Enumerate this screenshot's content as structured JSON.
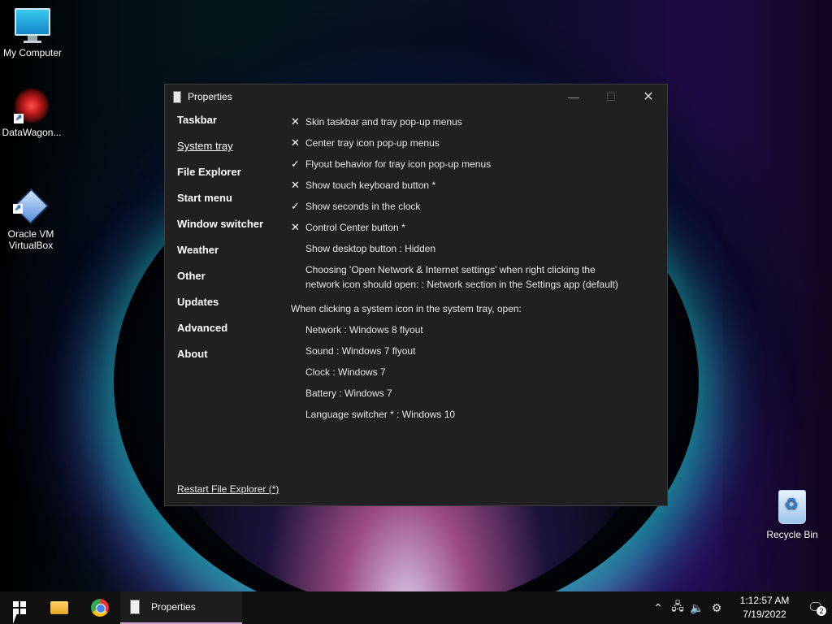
{
  "desktop": {
    "icons": [
      {
        "label": "My Computer"
      },
      {
        "label": "DataWagon..."
      },
      {
        "label": "Oracle VM\nVirtualBox"
      },
      {
        "label": "Recycle Bin"
      }
    ]
  },
  "window": {
    "title": "Properties",
    "controls": {
      "minimize": "—",
      "maximize": "☐",
      "close": "✕"
    },
    "nav": [
      {
        "label": "Taskbar"
      },
      {
        "label": "System tray",
        "active": true
      },
      {
        "label": "File Explorer"
      },
      {
        "label": "Start menu"
      },
      {
        "label": "Window switcher"
      },
      {
        "label": "Weather"
      },
      {
        "label": "Other"
      },
      {
        "label": "Updates"
      },
      {
        "label": "Advanced"
      },
      {
        "label": "About"
      }
    ],
    "settings": [
      {
        "mark": "✕",
        "label": "Skin taskbar and tray pop-up menus"
      },
      {
        "mark": "✕",
        "label": "Center tray icon pop-up menus"
      },
      {
        "mark": "✓",
        "label": "Flyout behavior for tray icon pop-up menus"
      },
      {
        "mark": "✕",
        "label": "Show touch keyboard button *"
      },
      {
        "mark": "✓",
        "label": "Show seconds in the clock"
      },
      {
        "mark": "✕",
        "label": "Control Center button *"
      },
      {
        "mark": "",
        "label": "Show desktop button : Hidden"
      },
      {
        "mark": "",
        "label": "Choosing 'Open Network & Internet settings' when right clicking the network icon should open: : Network section in the Settings app (default)"
      }
    ],
    "tray_section_header": "When clicking a system icon in the system tray, open:",
    "tray_options": [
      {
        "label": "Network : Windows 8 flyout"
      },
      {
        "label": "Sound : Windows 7 flyout"
      },
      {
        "label": "Clock : Windows 7"
      },
      {
        "label": "Battery : Windows 7"
      },
      {
        "label": "Language switcher * : Windows 10"
      }
    ],
    "restart_link": "Restart File Explorer (*)"
  },
  "taskbar": {
    "active_task": "Properties",
    "tray_icons": [
      "chevron-up-icon",
      "network-icon",
      "volume-icon",
      "gear-icon"
    ],
    "clock_time": "1:12:57 AM",
    "clock_date": "7/19/2022",
    "notification_count": "2"
  }
}
